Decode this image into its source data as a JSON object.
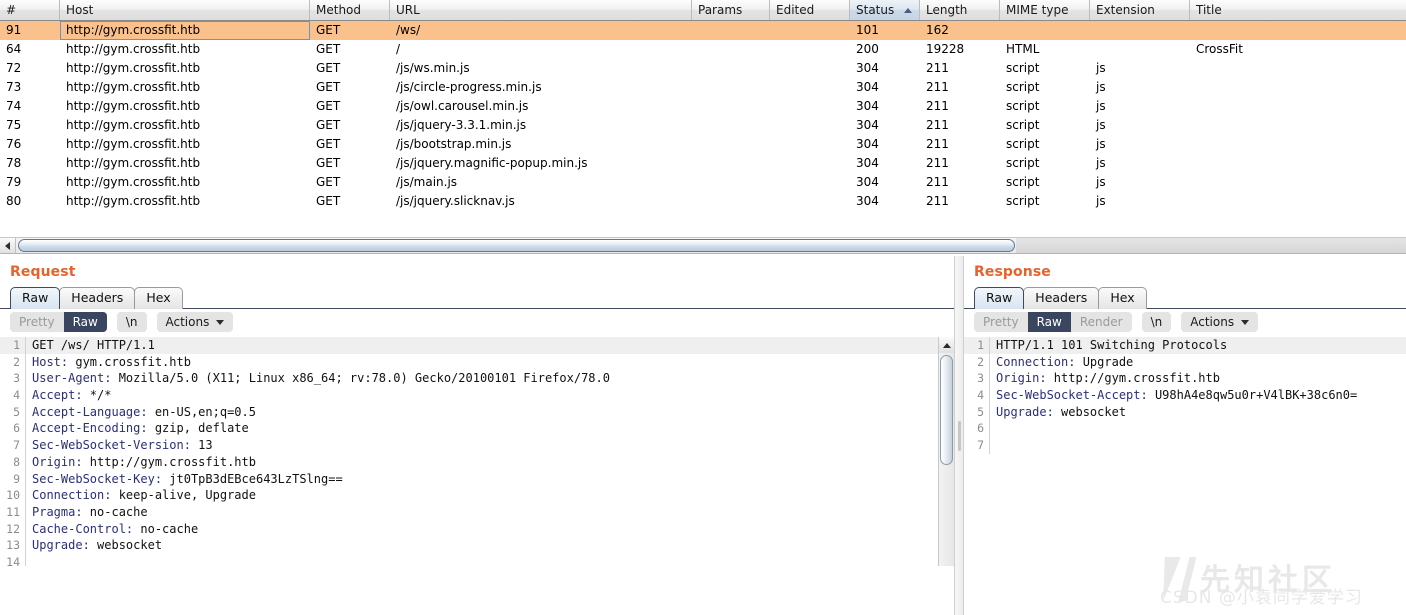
{
  "history": {
    "columns": [
      {
        "key": "num",
        "label": "#",
        "sorted": false
      },
      {
        "key": "host",
        "label": "Host",
        "sorted": false
      },
      {
        "key": "method",
        "label": "Method",
        "sorted": false
      },
      {
        "key": "url",
        "label": "URL",
        "sorted": false
      },
      {
        "key": "params",
        "label": "Params",
        "sorted": false
      },
      {
        "key": "edited",
        "label": "Edited",
        "sorted": false
      },
      {
        "key": "status",
        "label": "Status",
        "sorted": true,
        "sort_direction": "ascending"
      },
      {
        "key": "length",
        "label": "Length",
        "sorted": false
      },
      {
        "key": "mime",
        "label": "MIME type",
        "sorted": false
      },
      {
        "key": "ext",
        "label": "Extension",
        "sorted": false
      },
      {
        "key": "title",
        "label": "Title",
        "sorted": false
      }
    ],
    "selected_row_index": 0,
    "selection_color": "#fbc18c",
    "rows": [
      {
        "num": "91",
        "host": "http://gym.crossfit.htb",
        "method": "GET",
        "url": "/ws/",
        "params": "",
        "edited": "",
        "status": "101",
        "length": "162",
        "mime": "",
        "ext": "",
        "title": ""
      },
      {
        "num": "64",
        "host": "http://gym.crossfit.htb",
        "method": "GET",
        "url": "/",
        "params": "",
        "edited": "",
        "status": "200",
        "length": "19228",
        "mime": "HTML",
        "ext": "",
        "title": "CrossFit"
      },
      {
        "num": "72",
        "host": "http://gym.crossfit.htb",
        "method": "GET",
        "url": "/js/ws.min.js",
        "params": "",
        "edited": "",
        "status": "304",
        "length": "211",
        "mime": "script",
        "ext": "js",
        "title": ""
      },
      {
        "num": "73",
        "host": "http://gym.crossfit.htb",
        "method": "GET",
        "url": "/js/circle-progress.min.js",
        "params": "",
        "edited": "",
        "status": "304",
        "length": "211",
        "mime": "script",
        "ext": "js",
        "title": ""
      },
      {
        "num": "74",
        "host": "http://gym.crossfit.htb",
        "method": "GET",
        "url": "/js/owl.carousel.min.js",
        "params": "",
        "edited": "",
        "status": "304",
        "length": "211",
        "mime": "script",
        "ext": "js",
        "title": ""
      },
      {
        "num": "75",
        "host": "http://gym.crossfit.htb",
        "method": "GET",
        "url": "/js/jquery-3.3.1.min.js",
        "params": "",
        "edited": "",
        "status": "304",
        "length": "211",
        "mime": "script",
        "ext": "js",
        "title": ""
      },
      {
        "num": "76",
        "host": "http://gym.crossfit.htb",
        "method": "GET",
        "url": "/js/bootstrap.min.js",
        "params": "",
        "edited": "",
        "status": "304",
        "length": "211",
        "mime": "script",
        "ext": "js",
        "title": ""
      },
      {
        "num": "78",
        "host": "http://gym.crossfit.htb",
        "method": "GET",
        "url": "/js/jquery.magnific-popup.min.js",
        "params": "",
        "edited": "",
        "status": "304",
        "length": "211",
        "mime": "script",
        "ext": "js",
        "title": ""
      },
      {
        "num": "79",
        "host": "http://gym.crossfit.htb",
        "method": "GET",
        "url": "/js/main.js",
        "params": "",
        "edited": "",
        "status": "304",
        "length": "211",
        "mime": "script",
        "ext": "js",
        "title": ""
      },
      {
        "num": "80",
        "host": "http://gym.crossfit.htb",
        "method": "GET",
        "url": "/js/jquery.slicknav.js",
        "params": "",
        "edited": "",
        "status": "304",
        "length": "211",
        "mime": "script",
        "ext": "js",
        "title": ""
      }
    ]
  },
  "request": {
    "title": "Request",
    "accent_color": "#e8622a",
    "tabs": [
      {
        "label": "Raw",
        "active": true
      },
      {
        "label": "Headers",
        "active": false
      },
      {
        "label": "Hex",
        "active": false
      }
    ],
    "toolbar": {
      "view_modes": [
        {
          "label": "Pretty",
          "active": false
        },
        {
          "label": "Raw",
          "active": true
        }
      ],
      "newline_label": "\\n",
      "actions_label": "Actions"
    },
    "lines": [
      {
        "n": "1",
        "key": "",
        "value": "GET /ws/ HTTP/1.1"
      },
      {
        "n": "2",
        "key": "Host:",
        "value": " gym.crossfit.htb"
      },
      {
        "n": "3",
        "key": "User-Agent:",
        "value": " Mozilla/5.0 (X11; Linux x86_64; rv:78.0) Gecko/20100101 Firefox/78.0"
      },
      {
        "n": "4",
        "key": "Accept:",
        "value": " */*"
      },
      {
        "n": "5",
        "key": "Accept-Language:",
        "value": " en-US,en;q=0.5"
      },
      {
        "n": "6",
        "key": "Accept-Encoding:",
        "value": " gzip, deflate"
      },
      {
        "n": "7",
        "key": "Sec-WebSocket-Version:",
        "value": " 13"
      },
      {
        "n": "8",
        "key": "Origin:",
        "value": " http://gym.crossfit.htb"
      },
      {
        "n": "9",
        "key": "Sec-WebSocket-Key:",
        "value": " jt0TpB3dEBce643LzTSlng=="
      },
      {
        "n": "10",
        "key": "Connection:",
        "value": " keep-alive, Upgrade"
      },
      {
        "n": "11",
        "key": "Pragma:",
        "value": " no-cache"
      },
      {
        "n": "12",
        "key": "Cache-Control:",
        "value": " no-cache"
      },
      {
        "n": "13",
        "key": "Upgrade:",
        "value": " websocket"
      },
      {
        "n": "14",
        "key": "",
        "value": ""
      }
    ]
  },
  "response": {
    "title": "Response",
    "accent_color": "#e8622a",
    "tabs": [
      {
        "label": "Raw",
        "active": true
      },
      {
        "label": "Headers",
        "active": false
      },
      {
        "label": "Hex",
        "active": false
      }
    ],
    "toolbar": {
      "view_modes": [
        {
          "label": "Pretty",
          "active": false
        },
        {
          "label": "Raw",
          "active": true
        },
        {
          "label": "Render",
          "active": false
        }
      ],
      "newline_label": "\\n",
      "actions_label": "Actions"
    },
    "lines": [
      {
        "n": "1",
        "key": "",
        "value": "HTTP/1.1 101 Switching Protocols"
      },
      {
        "n": "2",
        "key": "Connection:",
        "value": " Upgrade"
      },
      {
        "n": "3",
        "key": "Origin:",
        "value": " http://gym.crossfit.htb"
      },
      {
        "n": "4",
        "key": "Sec-WebSocket-Accept:",
        "value": " U98hA4e8qw5u0r+V4lBK+38c6n0="
      },
      {
        "n": "5",
        "key": "Upgrade:",
        "value": " websocket"
      },
      {
        "n": "6",
        "key": "",
        "value": ""
      },
      {
        "n": "7",
        "key": "",
        "value": ""
      }
    ]
  },
  "watermark": {
    "big_text": "先知社区",
    "small_text": "CSDN @小袁同学爱学习"
  }
}
